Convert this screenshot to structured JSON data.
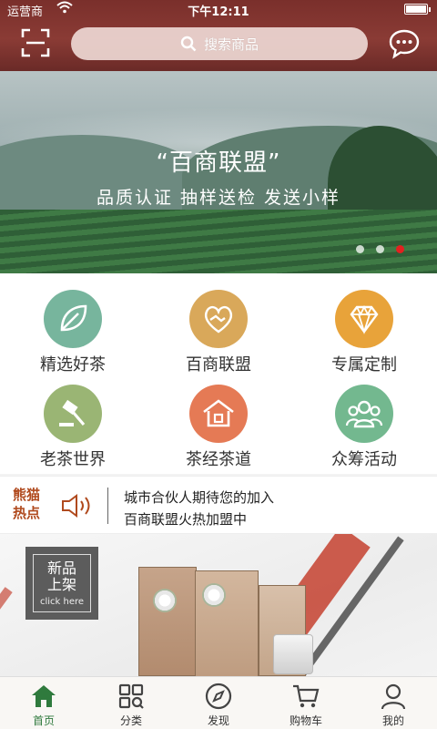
{
  "status_bar": {
    "carrier": "运营商",
    "time": "下午12:11",
    "battery_level": 1.0
  },
  "header": {
    "search_placeholder": "搜索商品",
    "icons": {
      "scan": "scan-icon",
      "search": "search-icon",
      "message": "chat-bubble-icon"
    }
  },
  "hero": {
    "title": "“百商联盟”",
    "subtitle": "品质认证  抽样送检  发送小样",
    "dots_count": 3,
    "active_dot": 3
  },
  "grid": [
    {
      "label": "精选好茶",
      "icon": "tea-leaf-icon",
      "color": "#77b59d"
    },
    {
      "label": "百商联盟",
      "icon": "handshake-heart-icon",
      "color": "#d9a85a"
    },
    {
      "label": "专属定制",
      "icon": "diamond-icon",
      "color": "#e8a33a"
    },
    {
      "label": "老茶世界",
      "icon": "gavel-icon",
      "color": "#9ab574"
    },
    {
      "label": "茶经茶道",
      "icon": "pavilion-icon",
      "color": "#e57a55"
    },
    {
      "label": "众筹活动",
      "icon": "group-icon",
      "color": "#73b88f"
    }
  ],
  "news": {
    "brand": "熊猫热点",
    "items": [
      "城市合伙人期待您的加入",
      "百商联盟火热加盟中"
    ],
    "icon": "speaker-icon"
  },
  "promo": {
    "badge_line1": "新品",
    "badge_line2": "上架",
    "badge_sub": "click here"
  },
  "tabbar": [
    {
      "label": "首页",
      "icon": "home-icon",
      "active": true
    },
    {
      "label": "分类",
      "icon": "category-icon",
      "active": false
    },
    {
      "label": "发现",
      "icon": "compass-icon",
      "active": false
    },
    {
      "label": "购物车",
      "icon": "cart-icon",
      "active": false
    },
    {
      "label": "我的",
      "icon": "user-icon",
      "active": false
    }
  ],
  "colors": {
    "header_bg": "#7a2f2b",
    "active_tab": "#2f7a3d",
    "active_dot": "#e32020",
    "brand_text": "#b04a1e"
  }
}
